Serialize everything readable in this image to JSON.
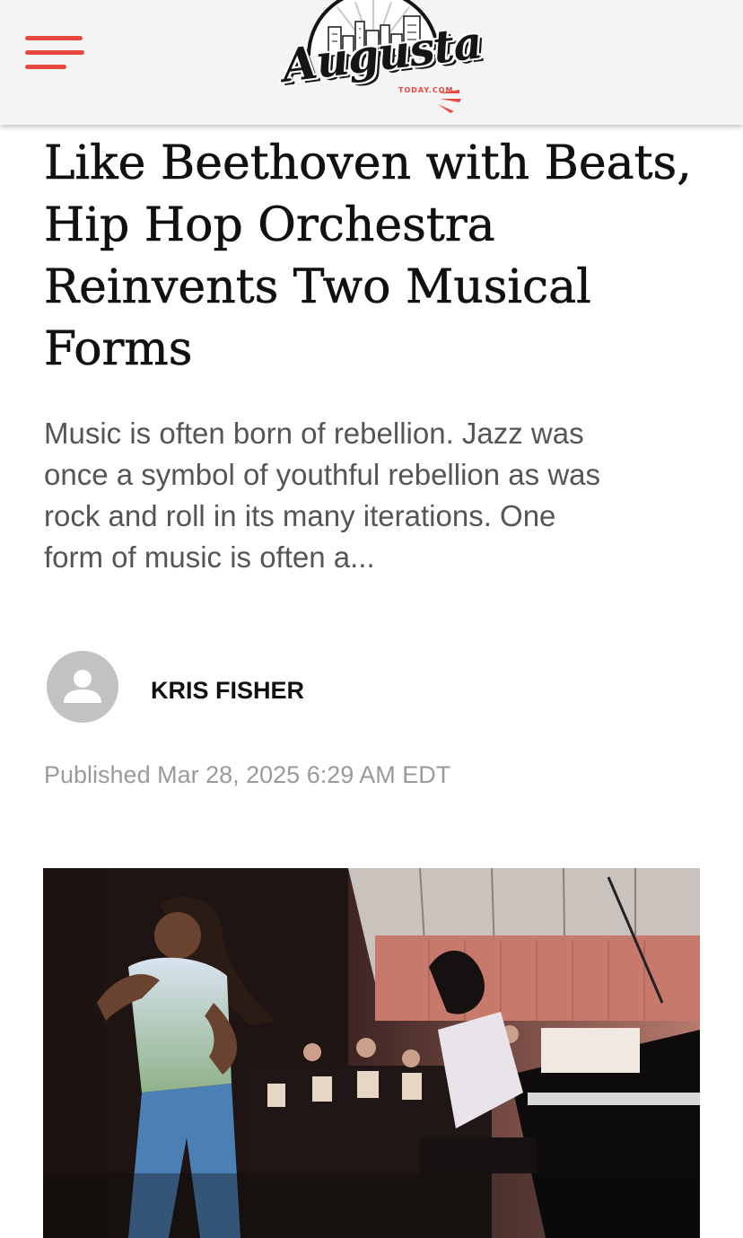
{
  "header": {
    "menu_icon": "hamburger-menu-icon",
    "logo": {
      "wordmark": "Augusta",
      "subtext": "TODAY.COM"
    }
  },
  "article": {
    "title": "Like Beethoven with Beats, Hip Hop Orchestra Reinvents Two Musical Forms",
    "summary": "Music is often born of rebellion. Jazz was once a symbol of youthful rebellion as was rock and roll in its many iterations. One form of music is often a...",
    "author": {
      "name": "KRIS FISHER",
      "avatar_icon": "person-icon"
    },
    "published": "Published Mar 28, 2025 6:29 AM EDT"
  },
  "colors": {
    "accent": "#e8483f",
    "header_bg": "#f4f4f4",
    "title": "#111111",
    "summary": "#555555",
    "meta": "#9a9a9a",
    "avatar_bg": "#c2c2c2"
  }
}
